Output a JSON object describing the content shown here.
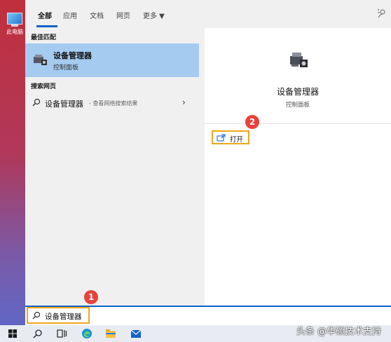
{
  "desktop": {
    "icon_label": "此电脑"
  },
  "tabs": [
    {
      "label": "全部",
      "active": true
    },
    {
      "label": "应用"
    },
    {
      "label": "文档"
    },
    {
      "label": "网页"
    },
    {
      "label": "更多 ▼"
    }
  ],
  "left": {
    "best_match_title": "最佳匹配",
    "best_match": {
      "name": "设备管理器",
      "type": "控制面板"
    },
    "web_title": "搜索网页",
    "web_result": {
      "query": "设备管理器",
      "suffix": "- 查看网络搜索结果",
      "chevron": "›"
    }
  },
  "right": {
    "app_name": "设备管理器",
    "app_type": "控制面板",
    "open_label": "打开"
  },
  "badges": {
    "step1": "1",
    "step2": "2"
  },
  "search": {
    "value": "设备管理器"
  },
  "watermark": "头条 @华硕技术支持",
  "colors": {
    "accent": "#0a63c8",
    "highlight": "#f2a61c",
    "badge": "#e8423a",
    "selected": "#a5cbf1"
  },
  "icons": [
    "device-manager-icon",
    "search-icon",
    "chevron-right-icon",
    "open-icon",
    "feedback-icon",
    "windows-icon",
    "task-view-icon",
    "edge-icon",
    "file-explorer-icon",
    "mail-icon"
  ]
}
